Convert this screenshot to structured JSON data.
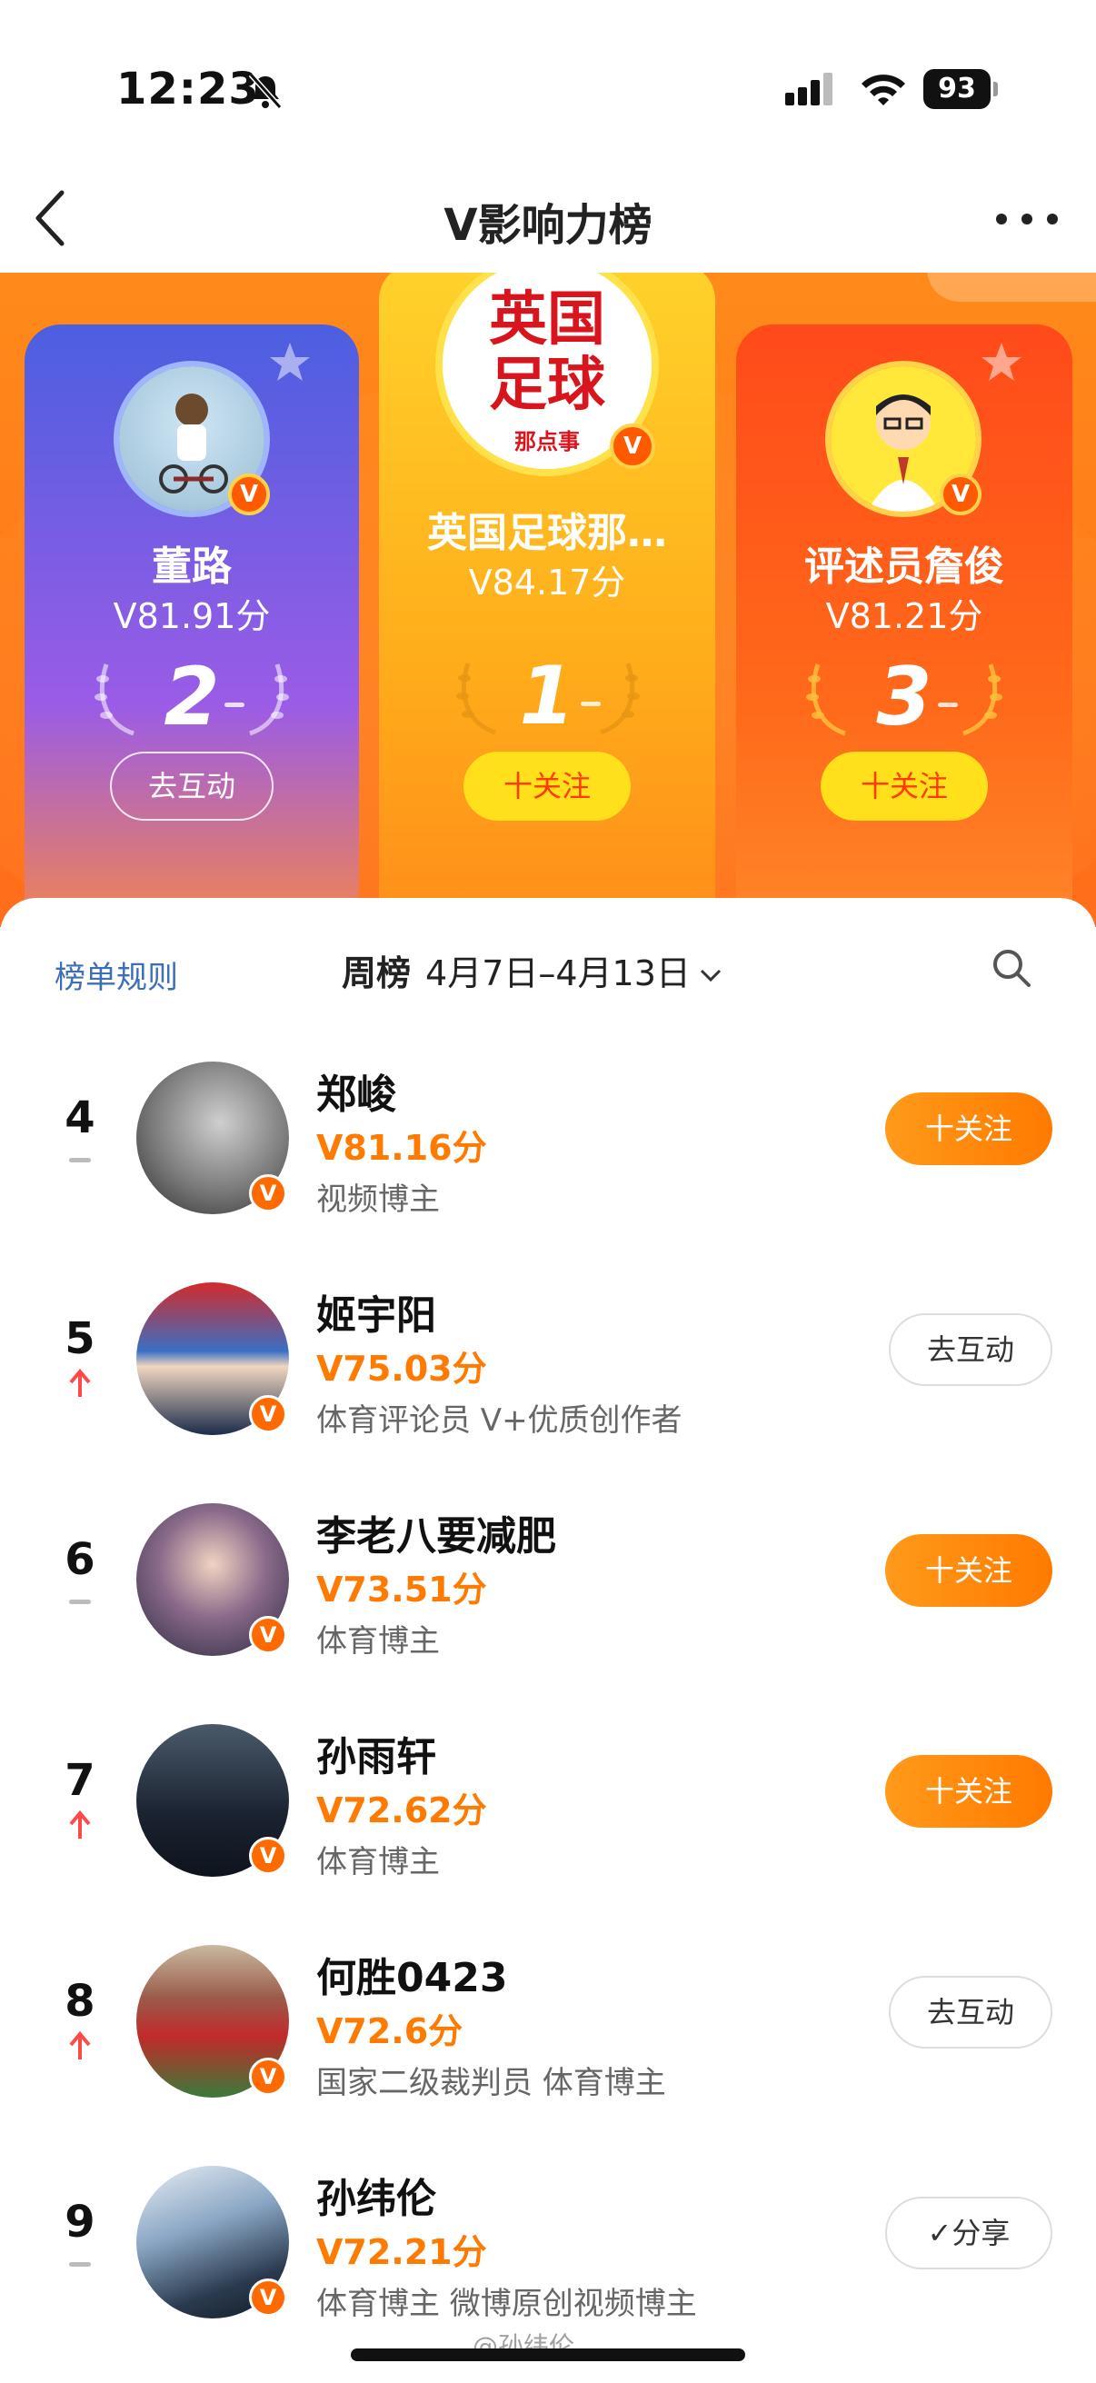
{
  "status_bar": {
    "time": "12:23",
    "battery": "93"
  },
  "nav": {
    "title": "V影响力榜"
  },
  "podium": [
    {
      "rank": "2",
      "name": "董路",
      "score": "V81.91分",
      "button": "去互动",
      "button_type": "interact"
    },
    {
      "rank": "1",
      "name": "英国足球那…",
      "score": "V84.17分",
      "button": "十关注",
      "button_type": "follow",
      "avatar_text": "英国足球",
      "avatar_sub": "那点事"
    },
    {
      "rank": "3",
      "name": "评述员詹俊",
      "score": "V81.21分",
      "button": "十关注",
      "button_type": "follow"
    }
  ],
  "list_header": {
    "rules": "榜单规则",
    "period_label": "周榜",
    "period_range": "4月7日–4月13日"
  },
  "rows": [
    {
      "rank": "4",
      "trend": "flat",
      "name": "郑峻",
      "score": "81.16分",
      "desc": "视频博主",
      "button": "十关注",
      "button_type": "follow"
    },
    {
      "rank": "5",
      "trend": "up",
      "name": "姬宇阳",
      "score": "75.03分",
      "desc": "体育评论员 V+优质创作者",
      "button": "去互动",
      "button_type": "interact"
    },
    {
      "rank": "6",
      "trend": "flat",
      "name": "李老八要减肥",
      "score": "73.51分",
      "desc": "体育博主",
      "button": "十关注",
      "button_type": "follow"
    },
    {
      "rank": "7",
      "trend": "up",
      "name": "孙雨轩",
      "score": "72.62分",
      "desc": "体育博主",
      "button": "十关注",
      "button_type": "follow"
    },
    {
      "rank": "8",
      "trend": "up",
      "name": "何胜0423",
      "score": "72.6分",
      "desc": "国家二级裁判员 体育博主",
      "button": "去互动",
      "button_type": "interact"
    },
    {
      "rank": "9",
      "trend": "flat",
      "name": "孙纬伦",
      "score": "72.21分",
      "desc": "体育博主 微博原创视频博主",
      "button": "分享",
      "button_type": "share"
    }
  ],
  "watermark": "@孙纬伦",
  "colors": {
    "accent_orange": "#ff7a00",
    "link_blue": "#3d6fb8",
    "podium_bg": "#ff7a1a"
  },
  "icons": [
    "bell-slash-icon",
    "signal-icon",
    "wifi-icon",
    "battery-icon",
    "back-icon",
    "more-icon",
    "search-icon",
    "chevron-down-icon",
    "laurel-icon",
    "up-arrow-icon",
    "check-icon",
    "v-badge-icon"
  ]
}
